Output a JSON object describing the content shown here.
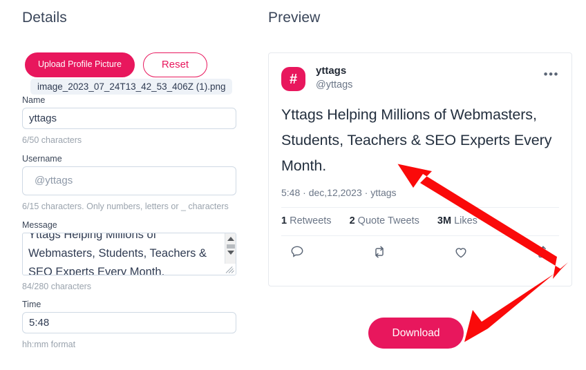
{
  "details": {
    "heading": "Details",
    "upload_button": "Upload Profile Picture",
    "reset_button": "Reset",
    "file_name": "image_2023_07_24T13_42_53_406Z (1).png",
    "fields": {
      "name": {
        "label": "Name",
        "value": "yttags",
        "helper": "6/50 characters"
      },
      "username": {
        "label": "Username",
        "value": "@yttags",
        "placeholder": "@yttags",
        "helper": "6/15 characters. Only numbers, letters or _ characters"
      },
      "message": {
        "label": "Message",
        "value": "Yttags Helping Millions of Webmasters, Students, Teachers & SEO Experts Every Month.",
        "helper": "84/280 characters"
      },
      "time": {
        "label": "Time",
        "value": "5:48",
        "helper": "hh:mm format"
      }
    }
  },
  "preview": {
    "heading": "Preview",
    "card": {
      "avatar_icon": "hashtag-icon",
      "display_name": "yttags",
      "handle": "@yttags",
      "more_icon": "ellipsis-icon",
      "tweet_text": "Yttags Helping Millions of Webmasters, Students, Teachers & SEO Experts Every Month.",
      "meta": "5:48 · dec,12,2023 · yttags",
      "stats": [
        {
          "count": "1",
          "label": "Retweets"
        },
        {
          "count": "2",
          "label": "Quote Tweets"
        },
        {
          "count": "3M",
          "label": "Likes"
        }
      ],
      "actions": [
        {
          "icon": "reply-icon"
        },
        {
          "icon": "retweet-icon"
        },
        {
          "icon": "like-icon"
        },
        {
          "icon": "share-icon"
        }
      ]
    }
  },
  "download_button": "Download",
  "annotation": {
    "arrow_color": "#fa0a0a",
    "shape": "double-headed-elbow-arrow"
  },
  "colors": {
    "accent": "#e8175d",
    "text": "#2f3b52",
    "muted": "#9aa3ad",
    "border": "#cfd9e4",
    "arrow": "#fa0a0a"
  }
}
